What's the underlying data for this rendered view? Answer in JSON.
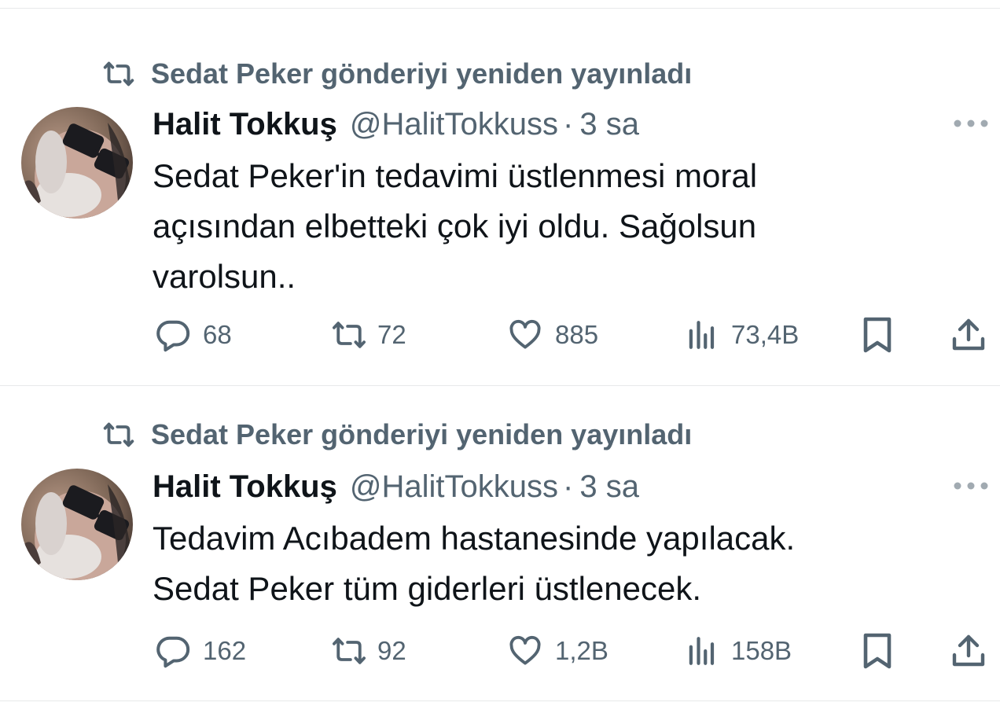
{
  "tweets": [
    {
      "repost_text": "Sedat Peker gönderiyi yeniden yayınladı",
      "author_name": "Halit Tokkuş",
      "handle": "@HalitTokkuss",
      "separator": "·",
      "time": "3 sa",
      "text_lines": [
        "Sedat Peker'in tedavimi üstlenmesi moral",
        "açısından elbetteki çok iyi oldu. Sağolsun",
        "varolsun.."
      ],
      "replies": "68",
      "reposts": "72",
      "likes": "885",
      "views": "73,4B"
    },
    {
      "repost_text": "Sedat Peker gönderiyi yeniden yayınladı",
      "author_name": "Halit Tokkuş",
      "handle": "@HalitTokkuss",
      "separator": "·",
      "time": "3 sa",
      "text_lines": [
        "Tedavim Acıbadem hastanesinde yapılacak.",
        "Sedat Peker tüm giderleri üstlenecek."
      ],
      "replies": "162",
      "reposts": "92",
      "likes": "1,2B",
      "views": "158B"
    }
  ],
  "icons": {
    "repost": "repost-icon",
    "reply": "reply-icon",
    "like": "heart-icon",
    "views": "views-icon",
    "bookmark": "bookmark-icon",
    "share": "share-icon",
    "more": "more-icon"
  },
  "colors": {
    "text": "#0f1419",
    "secondary": "#536471",
    "divider": "#e7e9ea"
  }
}
